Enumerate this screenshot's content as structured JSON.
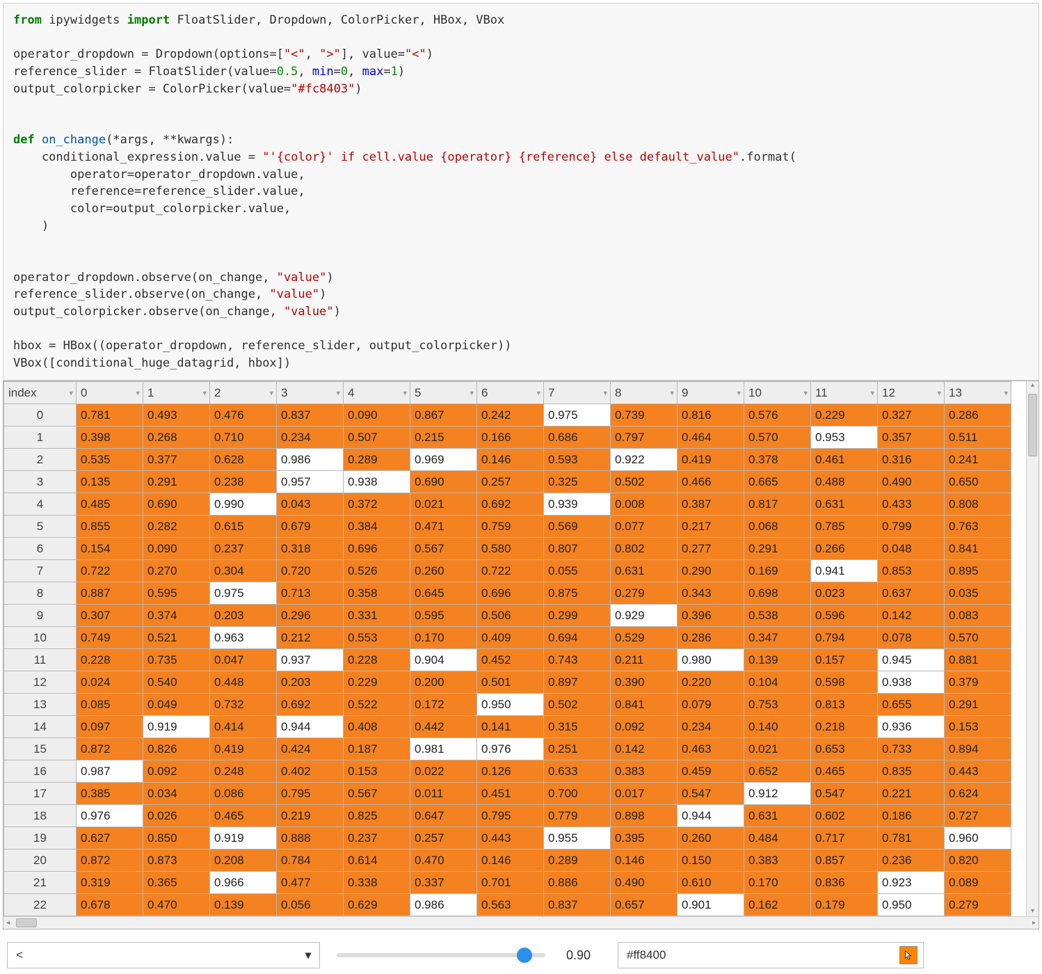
{
  "code": {
    "tokens": [
      [
        "kw-green",
        "from"
      ],
      [
        "",
        " ipywidgets "
      ],
      [
        "kw-green",
        "import"
      ],
      [
        "",
        " FloatSlider, Dropdown, ColorPicker, HBox, VBox\n\n"
      ],
      [
        "",
        "operator_dropdown "
      ],
      [
        "",
        "="
      ],
      [
        "",
        " Dropdown(options"
      ],
      [
        "",
        "="
      ],
      [
        "",
        "["
      ],
      [
        "str-red",
        "\"<\""
      ],
      [
        "",
        ", "
      ],
      [
        "str-red",
        "\">\""
      ],
      [
        "",
        "], value"
      ],
      [
        "",
        "="
      ],
      [
        "str-red",
        "\"<\""
      ],
      [
        "",
        ")\n"
      ],
      [
        "",
        "reference_slider "
      ],
      [
        "",
        "="
      ],
      [
        "",
        " FloatSlider(value"
      ],
      [
        "",
        "="
      ],
      [
        "num-green",
        "0.5"
      ],
      [
        "",
        ", "
      ],
      [
        "kw-blue",
        "min"
      ],
      [
        "",
        "="
      ],
      [
        "num-green",
        "0"
      ],
      [
        "",
        ", "
      ],
      [
        "kw-blue",
        "max"
      ],
      [
        "",
        "="
      ],
      [
        "num-green",
        "1"
      ],
      [
        "",
        ")\n"
      ],
      [
        "",
        "output_colorpicker "
      ],
      [
        "",
        "="
      ],
      [
        "",
        " ColorPicker(value"
      ],
      [
        "",
        "="
      ],
      [
        "str-red",
        "\"#fc8403\""
      ],
      [
        "",
        ")\n\n\n"
      ],
      [
        "kw-green",
        "def"
      ],
      [
        "",
        " "
      ],
      [
        "fn-blue",
        "on_change"
      ],
      [
        "",
        "("
      ],
      [
        "",
        "*"
      ],
      [
        "",
        "args, "
      ],
      [
        "",
        "**"
      ],
      [
        "",
        "kwargs):\n"
      ],
      [
        "",
        "    conditional_expression"
      ],
      [
        "",
        "."
      ],
      [
        "",
        "value "
      ],
      [
        "",
        "="
      ],
      [
        "",
        " "
      ],
      [
        "str-red",
        "\"'{color}' if cell.value {operator} {reference} else default_value\""
      ],
      [
        "",
        "."
      ],
      [
        "",
        "format(\n"
      ],
      [
        "",
        "        operator"
      ],
      [
        "",
        "="
      ],
      [
        "",
        "operator_dropdown"
      ],
      [
        "",
        "."
      ],
      [
        "",
        "value,\n"
      ],
      [
        "",
        "        reference"
      ],
      [
        "",
        "="
      ],
      [
        "",
        "reference_slider"
      ],
      [
        "",
        "."
      ],
      [
        "",
        "value,\n"
      ],
      [
        "",
        "        color"
      ],
      [
        "",
        "="
      ],
      [
        "",
        "output_colorpicker"
      ],
      [
        "",
        "."
      ],
      [
        "",
        "value,\n"
      ],
      [
        "",
        "    )\n\n\n"
      ],
      [
        "",
        "operator_dropdown"
      ],
      [
        "",
        "."
      ],
      [
        "",
        "observe(on_change, "
      ],
      [
        "str-red",
        "\"value\""
      ],
      [
        "",
        ")\n"
      ],
      [
        "",
        "reference_slider"
      ],
      [
        "",
        "."
      ],
      [
        "",
        "observe(on_change, "
      ],
      [
        "str-red",
        "\"value\""
      ],
      [
        "",
        ")\n"
      ],
      [
        "",
        "output_colorpicker"
      ],
      [
        "",
        "."
      ],
      [
        "",
        "observe(on_change, "
      ],
      [
        "str-red",
        "\"value\""
      ],
      [
        "",
        ")\n\n"
      ],
      [
        "",
        "hbox "
      ],
      [
        "",
        "="
      ],
      [
        "",
        " HBox((operator_dropdown, reference_slider, output_colorpicker))\n"
      ],
      [
        "",
        "VBox([conditional_huge_datagrid, hbox])"
      ]
    ]
  },
  "grid": {
    "index_label": "index",
    "columns": [
      "0",
      "1",
      "2",
      "3",
      "4",
      "5",
      "6",
      "7",
      "8",
      "9",
      "10",
      "11",
      "12",
      "13"
    ],
    "row_index": [
      "0",
      "1",
      "2",
      "3",
      "4",
      "5",
      "6",
      "7",
      "8",
      "9",
      "10",
      "11",
      "12",
      "13",
      "14",
      "15",
      "16",
      "17",
      "18",
      "19",
      "20",
      "21",
      "22"
    ],
    "threshold": 0.9,
    "rows": [
      [
        0.781,
        0.493,
        0.476,
        0.837,
        0.09,
        0.867,
        0.242,
        0.975,
        0.739,
        0.816,
        0.576,
        0.229,
        0.327,
        0.286
      ],
      [
        0.398,
        0.268,
        0.71,
        0.234,
        0.507,
        0.215,
        0.166,
        0.686,
        0.797,
        0.464,
        0.57,
        0.953,
        0.357,
        0.511
      ],
      [
        0.535,
        0.377,
        0.628,
        0.986,
        0.289,
        0.969,
        0.146,
        0.593,
        0.922,
        0.419,
        0.378,
        0.461,
        0.316,
        0.241
      ],
      [
        0.135,
        0.291,
        0.238,
        0.957,
        0.938,
        0.69,
        0.257,
        0.325,
        0.502,
        0.466,
        0.665,
        0.488,
        0.49,
        0.65
      ],
      [
        0.485,
        0.69,
        0.99,
        0.043,
        0.372,
        0.021,
        0.692,
        0.939,
        0.008,
        0.387,
        0.817,
        0.631,
        0.433,
        0.808
      ],
      [
        0.855,
        0.282,
        0.615,
        0.679,
        0.384,
        0.471,
        0.759,
        0.569,
        0.077,
        0.217,
        0.068,
        0.785,
        0.799,
        0.763
      ],
      [
        0.154,
        0.09,
        0.237,
        0.318,
        0.696,
        0.567,
        0.58,
        0.807,
        0.802,
        0.277,
        0.291,
        0.266,
        0.048,
        0.841
      ],
      [
        0.722,
        0.27,
        0.304,
        0.72,
        0.526,
        0.26,
        0.722,
        0.055,
        0.631,
        0.29,
        0.169,
        0.941,
        0.853,
        0.895
      ],
      [
        0.887,
        0.595,
        0.975,
        0.713,
        0.358,
        0.645,
        0.696,
        0.875,
        0.279,
        0.343,
        0.698,
        0.023,
        0.637,
        0.035
      ],
      [
        0.307,
        0.374,
        0.203,
        0.296,
        0.331,
        0.595,
        0.506,
        0.299,
        0.929,
        0.396,
        0.538,
        0.596,
        0.142,
        0.083
      ],
      [
        0.749,
        0.521,
        0.963,
        0.212,
        0.553,
        0.17,
        0.409,
        0.694,
        0.529,
        0.286,
        0.347,
        0.794,
        0.078,
        0.57
      ],
      [
        0.228,
        0.735,
        0.047,
        0.937,
        0.228,
        0.904,
        0.452,
        0.743,
        0.211,
        0.98,
        0.139,
        0.157,
        0.945,
        0.881
      ],
      [
        0.024,
        0.54,
        0.448,
        0.203,
        0.229,
        0.2,
        0.501,
        0.897,
        0.39,
        0.22,
        0.104,
        0.598,
        0.938,
        0.379
      ],
      [
        0.085,
        0.049,
        0.732,
        0.692,
        0.522,
        0.172,
        0.95,
        0.502,
        0.841,
        0.079,
        0.753,
        0.813,
        0.655,
        0.291
      ],
      [
        0.097,
        0.919,
        0.414,
        0.944,
        0.408,
        0.442,
        0.141,
        0.315,
        0.092,
        0.234,
        0.14,
        0.218,
        0.936,
        0.153
      ],
      [
        0.872,
        0.826,
        0.419,
        0.424,
        0.187,
        0.981,
        0.976,
        0.251,
        0.142,
        0.463,
        0.021,
        0.653,
        0.733,
        0.894
      ],
      [
        0.987,
        0.092,
        0.248,
        0.402,
        0.153,
        0.022,
        0.126,
        0.633,
        0.383,
        0.459,
        0.652,
        0.465,
        0.835,
        0.443
      ],
      [
        0.385,
        0.034,
        0.086,
        0.795,
        0.567,
        0.011,
        0.451,
        0.7,
        0.017,
        0.547,
        0.912,
        0.547,
        0.221,
        0.624
      ],
      [
        0.976,
        0.026,
        0.465,
        0.219,
        0.825,
        0.647,
        0.795,
        0.779,
        0.898,
        0.944,
        0.631,
        0.602,
        0.186,
        0.727
      ],
      [
        0.627,
        0.85,
        0.919,
        0.888,
        0.237,
        0.257,
        0.443,
        0.955,
        0.395,
        0.26,
        0.484,
        0.717,
        0.781,
        0.96
      ],
      [
        0.872,
        0.873,
        0.208,
        0.784,
        0.614,
        0.47,
        0.146,
        0.289,
        0.146,
        0.15,
        0.383,
        0.857,
        0.236,
        0.82
      ],
      [
        0.319,
        0.365,
        0.966,
        0.477,
        0.338,
        0.337,
        0.701,
        0.886,
        0.49,
        0.61,
        0.17,
        0.836,
        0.923,
        0.089
      ],
      [
        0.678,
        0.47,
        0.139,
        0.056,
        0.629,
        0.986,
        0.563,
        0.837,
        0.657,
        0.901,
        0.162,
        0.179,
        0.95,
        0.279
      ]
    ]
  },
  "controls": {
    "operator": "<",
    "slider_value_display": "0.90",
    "slider_fraction": 0.9,
    "color_hex": "#ff8400"
  },
  "chart_data": {
    "type": "table",
    "title": "conditional_huge_datagrid",
    "threshold": 0.9,
    "operator": "<",
    "highlight_color": "#ff8400",
    "columns": [
      "0",
      "1",
      "2",
      "3",
      "4",
      "5",
      "6",
      "7",
      "8",
      "9",
      "10",
      "11",
      "12",
      "13"
    ],
    "row_index": [
      0,
      1,
      2,
      3,
      4,
      5,
      6,
      7,
      8,
      9,
      10,
      11,
      12,
      13,
      14,
      15,
      16,
      17,
      18,
      19,
      20,
      21,
      22
    ],
    "values": [
      [
        0.781,
        0.493,
        0.476,
        0.837,
        0.09,
        0.867,
        0.242,
        0.975,
        0.739,
        0.816,
        0.576,
        0.229,
        0.327,
        0.286
      ],
      [
        0.398,
        0.268,
        0.71,
        0.234,
        0.507,
        0.215,
        0.166,
        0.686,
        0.797,
        0.464,
        0.57,
        0.953,
        0.357,
        0.511
      ],
      [
        0.535,
        0.377,
        0.628,
        0.986,
        0.289,
        0.969,
        0.146,
        0.593,
        0.922,
        0.419,
        0.378,
        0.461,
        0.316,
        0.241
      ],
      [
        0.135,
        0.291,
        0.238,
        0.957,
        0.938,
        0.69,
        0.257,
        0.325,
        0.502,
        0.466,
        0.665,
        0.488,
        0.49,
        0.65
      ],
      [
        0.485,
        0.69,
        0.99,
        0.043,
        0.372,
        0.021,
        0.692,
        0.939,
        0.008,
        0.387,
        0.817,
        0.631,
        0.433,
        0.808
      ],
      [
        0.855,
        0.282,
        0.615,
        0.679,
        0.384,
        0.471,
        0.759,
        0.569,
        0.077,
        0.217,
        0.068,
        0.785,
        0.799,
        0.763
      ],
      [
        0.154,
        0.09,
        0.237,
        0.318,
        0.696,
        0.567,
        0.58,
        0.807,
        0.802,
        0.277,
        0.291,
        0.266,
        0.048,
        0.841
      ],
      [
        0.722,
        0.27,
        0.304,
        0.72,
        0.526,
        0.26,
        0.722,
        0.055,
        0.631,
        0.29,
        0.169,
        0.941,
        0.853,
        0.895
      ],
      [
        0.887,
        0.595,
        0.975,
        0.713,
        0.358,
        0.645,
        0.696,
        0.875,
        0.279,
        0.343,
        0.698,
        0.023,
        0.637,
        0.035
      ],
      [
        0.307,
        0.374,
        0.203,
        0.296,
        0.331,
        0.595,
        0.506,
        0.299,
        0.929,
        0.396,
        0.538,
        0.596,
        0.142,
        0.083
      ],
      [
        0.749,
        0.521,
        0.963,
        0.212,
        0.553,
        0.17,
        0.409,
        0.694,
        0.529,
        0.286,
        0.347,
        0.794,
        0.078,
        0.57
      ],
      [
        0.228,
        0.735,
        0.047,
        0.937,
        0.228,
        0.904,
        0.452,
        0.743,
        0.211,
        0.98,
        0.139,
        0.157,
        0.945,
        0.881
      ],
      [
        0.024,
        0.54,
        0.448,
        0.203,
        0.229,
        0.2,
        0.501,
        0.897,
        0.39,
        0.22,
        0.104,
        0.598,
        0.938,
        0.379
      ],
      [
        0.085,
        0.049,
        0.732,
        0.692,
        0.522,
        0.172,
        0.95,
        0.502,
        0.841,
        0.079,
        0.753,
        0.813,
        0.655,
        0.291
      ],
      [
        0.097,
        0.919,
        0.414,
        0.944,
        0.408,
        0.442,
        0.141,
        0.315,
        0.092,
        0.234,
        0.14,
        0.218,
        0.936,
        0.153
      ],
      [
        0.872,
        0.826,
        0.419,
        0.424,
        0.187,
        0.981,
        0.976,
        0.251,
        0.142,
        0.463,
        0.021,
        0.653,
        0.733,
        0.894
      ],
      [
        0.987,
        0.092,
        0.248,
        0.402,
        0.153,
        0.022,
        0.126,
        0.633,
        0.383,
        0.459,
        0.652,
        0.465,
        0.835,
        0.443
      ],
      [
        0.385,
        0.034,
        0.086,
        0.795,
        0.567,
        0.011,
        0.451,
        0.7,
        0.017,
        0.547,
        0.912,
        0.547,
        0.221,
        0.624
      ],
      [
        0.976,
        0.026,
        0.465,
        0.219,
        0.825,
        0.647,
        0.795,
        0.779,
        0.898,
        0.944,
        0.631,
        0.602,
        0.186,
        0.727
      ],
      [
        0.627,
        0.85,
        0.919,
        0.888,
        0.237,
        0.257,
        0.443,
        0.955,
        0.395,
        0.26,
        0.484,
        0.717,
        0.781,
        0.96
      ],
      [
        0.872,
        0.873,
        0.208,
        0.784,
        0.614,
        0.47,
        0.146,
        0.289,
        0.146,
        0.15,
        0.383,
        0.857,
        0.236,
        0.82
      ],
      [
        0.319,
        0.365,
        0.966,
        0.477,
        0.338,
        0.337,
        0.701,
        0.886,
        0.49,
        0.61,
        0.17,
        0.836,
        0.923,
        0.089
      ],
      [
        0.678,
        0.47,
        0.139,
        0.056,
        0.629,
        0.986,
        0.563,
        0.837,
        0.657,
        0.901,
        0.162,
        0.179,
        0.95,
        0.279
      ]
    ]
  }
}
